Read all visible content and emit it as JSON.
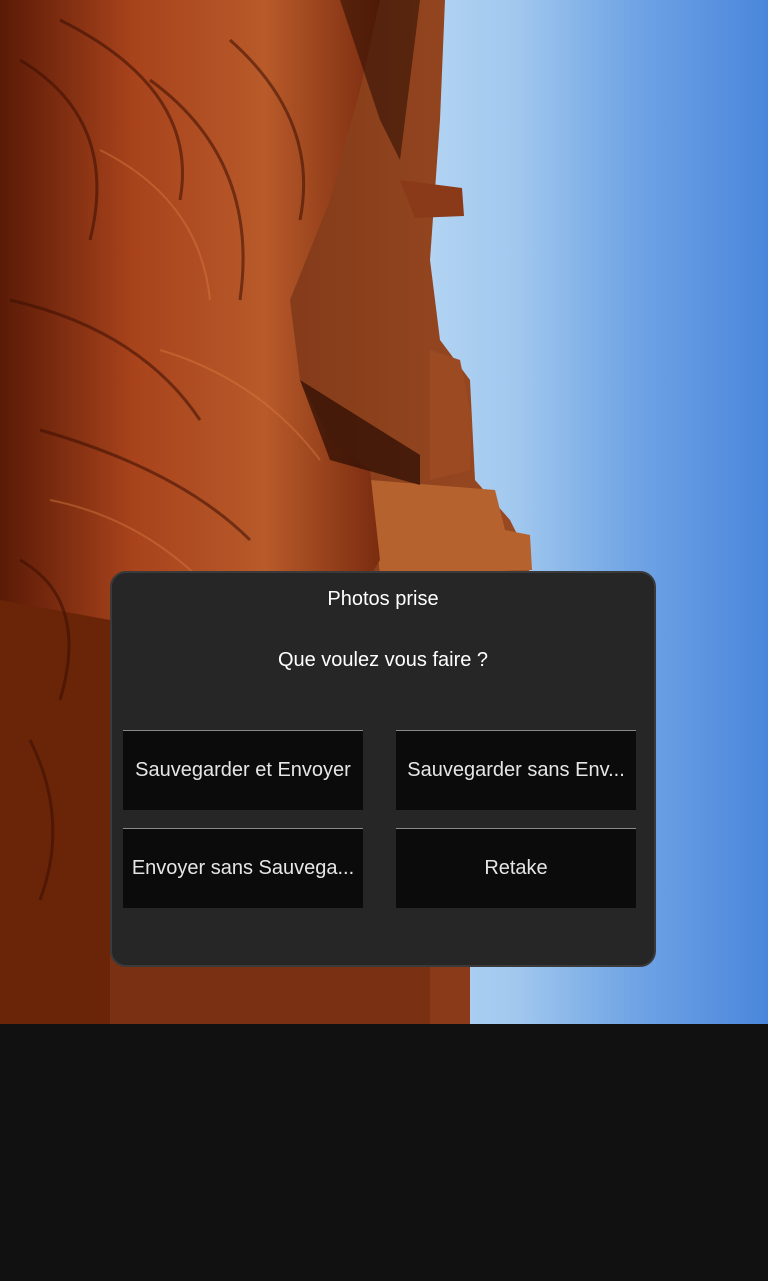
{
  "dialog": {
    "title": "Photos prise",
    "message": "Que voulez vous faire ?",
    "buttons": {
      "save_and_send": "Sauvegarder et Envoyer",
      "save_without_send": "Sauvegarder sans Env...",
      "send_without_save": "Envoyer sans Sauvega...",
      "retake": "Retake"
    }
  },
  "colors": {
    "dialog_background": "#262626",
    "button_background": "#0b0b0b",
    "screen_background": "#111111",
    "sky": "#4a8ee0",
    "rock": "#a8431c"
  }
}
